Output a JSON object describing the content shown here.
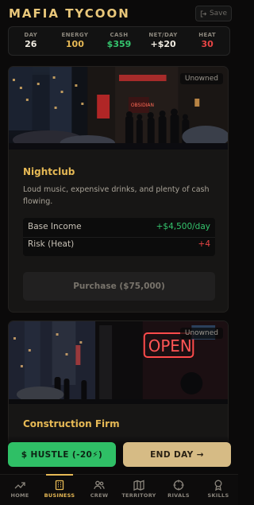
{
  "header": {
    "title": "MAFIA TYCOON",
    "save_label": "Save"
  },
  "stats": [
    {
      "label": "DAY",
      "value": "26",
      "color": "#f1ece2"
    },
    {
      "label": "ENERGY",
      "value": "100",
      "color": "#e6b955"
    },
    {
      "label": "CASH",
      "value": "$359",
      "color": "#34c46d"
    },
    {
      "label": "NET/DAY",
      "value": "+$20",
      "color": "#f1ece2"
    },
    {
      "label": "HEAT",
      "value": "30",
      "color": "#e84545"
    }
  ],
  "businesses": [
    {
      "status": "Unowned",
      "name": "Nightclub",
      "description": "Loud music, expensive drinks, and plenty of cash flowing.",
      "income_label": "Base Income",
      "income_value": "+$4,500/day",
      "risk_label": "Risk (Heat)",
      "risk_value": "+4",
      "purchase_label": "Purchase ($75,000)"
    },
    {
      "status": "Unowned",
      "name": "Construction Firm"
    }
  ],
  "actions": {
    "hustle_label": "$ HUSTLE (-20⚡)",
    "end_day_label": "END DAY →"
  },
  "nav": [
    {
      "label": "HOME",
      "icon": "trending-up-icon"
    },
    {
      "label": "BUSINESS",
      "icon": "building-icon",
      "active": true
    },
    {
      "label": "CREW",
      "icon": "users-icon"
    },
    {
      "label": "TERRITORY",
      "icon": "map-icon"
    },
    {
      "label": "RIVALS",
      "icon": "crosshair-icon"
    },
    {
      "label": "SKILLS",
      "icon": "award-icon"
    }
  ],
  "colors": {
    "accent": "#e6b955",
    "green": "#34c46d",
    "red": "#e84545"
  }
}
